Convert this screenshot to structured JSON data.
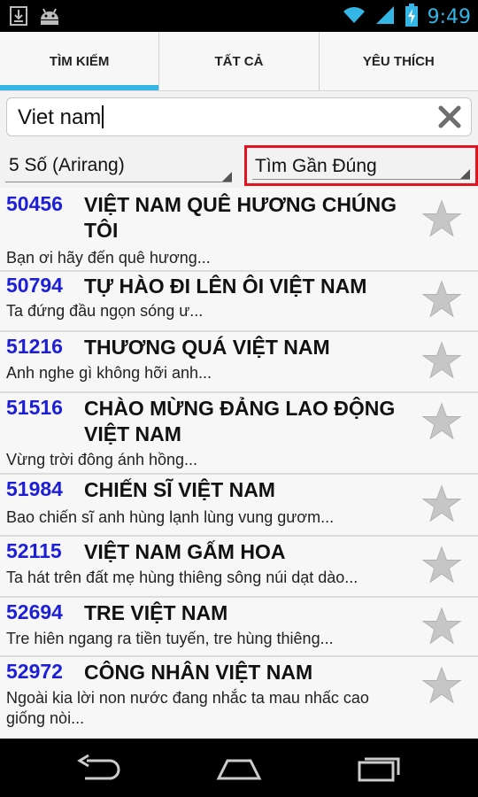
{
  "status_bar": {
    "time": "9:49",
    "icons": [
      "download-icon",
      "android-icon",
      "wifi-icon",
      "signal-icon",
      "battery-charging-icon"
    ]
  },
  "tabs": [
    {
      "label": "TÌM KIẾM",
      "active": true
    },
    {
      "label": "TẤT CẢ",
      "active": false
    },
    {
      "label": "YÊU THÍCH",
      "active": false
    }
  ],
  "search": {
    "value": "Viet nam",
    "clear_icon": "clear-x-icon"
  },
  "filters": {
    "category": "5 Số (Arirang)",
    "match_mode": "Tìm Gần Đúng"
  },
  "songs": [
    {
      "code": "50456",
      "title": "VIỆT NAM QUÊ HƯƠNG CHÚNG TÔI",
      "lyric": "Bạn ơi hãy đến quê hương..."
    },
    {
      "code": "50794",
      "title": "TỰ HÀO ĐI LÊN ÔI VIỆT NAM",
      "lyric": "Ta đứng đầu ngọn sóng ư..."
    },
    {
      "code": "51216",
      "title": "THƯƠNG QUÁ VIỆT NAM",
      "lyric": "Anh nghe gì không hỡi anh..."
    },
    {
      "code": "51516",
      "title": "CHÀO MỪNG ĐẢNG LAO ĐỘNG VIỆT NAM",
      "lyric": "Vừng trời đông ánh hồng..."
    },
    {
      "code": "51984",
      "title": "CHIẾN SĨ VIỆT NAM",
      "lyric": "Bao chiến sĩ anh hùng lạnh lùng vung gươm..."
    },
    {
      "code": "52115",
      "title": "VIỆT NAM GẤM HOA",
      "lyric": "Ta hát trên đất mẹ hùng thiêng sông núi dạt dào..."
    },
    {
      "code": "52694",
      "title": "TRE VIỆT NAM",
      "lyric": "Tre hiên ngang ra tiền tuyến, tre hùng thiêng..."
    },
    {
      "code": "52972",
      "title": "CÔNG NHÂN VIỆT NAM",
      "lyric": "Ngoài kia lời non nước đang nhắc ta mau nhấc cao giống nòi..."
    }
  ],
  "nav_bar": {
    "buttons": [
      "back-icon",
      "home-icon",
      "recent-apps-icon"
    ]
  }
}
